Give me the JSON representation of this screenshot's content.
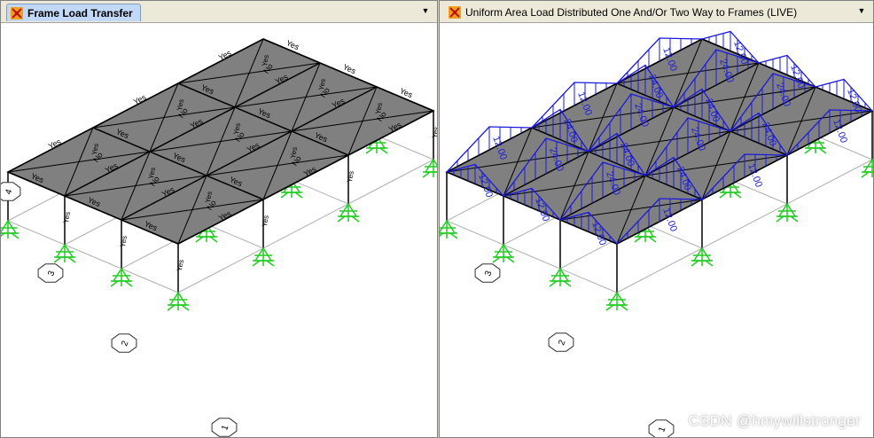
{
  "left_pane": {
    "tab_title": "Frame Load Transfer",
    "tab_icon": "sap-logo-icon",
    "dropdown_icon": "chevron-down-icon",
    "labels": {
      "yes": "Yes",
      "no": "No"
    },
    "grid_bubbles": [
      "4",
      "3",
      "2",
      "1"
    ]
  },
  "right_pane": {
    "tab_title": "Uniform Area Load Distributed One And/Or Two Way to Frames (LIVE)",
    "tab_icon": "sap-logo-icon",
    "dropdown_icon": "chevron-down-icon",
    "load_values": [
      "12.00",
      "24.00"
    ],
    "grid_bubbles": [
      "3",
      "2",
      "1"
    ]
  },
  "watermark": "CSDN @hmywillstronger",
  "colors": {
    "slab": "#808080",
    "support": "#22cc22",
    "load": "#1a1adc",
    "frame": "#000000"
  }
}
